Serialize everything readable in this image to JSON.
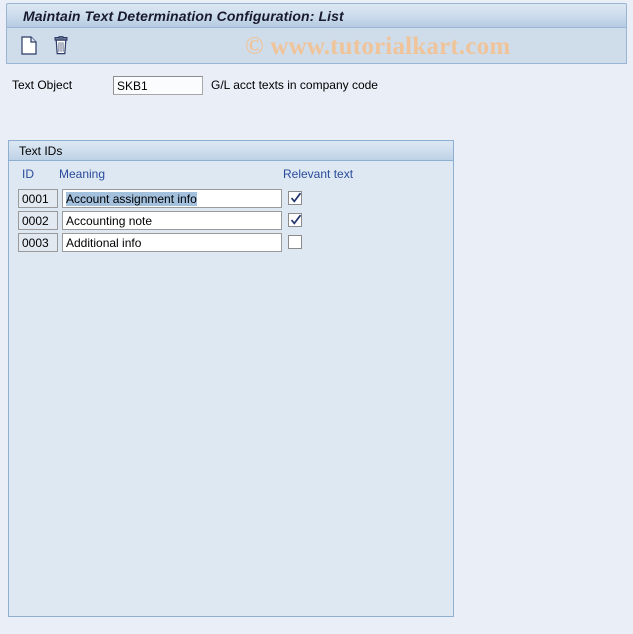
{
  "window": {
    "title": "Maintain Text Determination Configuration: List"
  },
  "toolbar": {
    "buttons": [
      {
        "name": "new-entries-icon",
        "tooltip": "New Entries"
      },
      {
        "name": "delete-icon",
        "tooltip": "Delete"
      }
    ]
  },
  "watermark": {
    "text": "© www.tutorialkart.com",
    "color": "#f0c49a"
  },
  "text_object": {
    "label": "Text Object",
    "value": "SKB1",
    "placeholder": "",
    "description": "G/L acct texts in company code"
  },
  "text_ids_panel": {
    "title": "Text IDs",
    "columns": {
      "id": "ID",
      "meaning": "Meaning",
      "relevant_text": "Relevant text"
    },
    "header_color": "#2a4b9b",
    "rows": [
      {
        "id": "0001",
        "meaning": "Account assignment info",
        "relevant_text": true,
        "selected": true
      },
      {
        "id": "0002",
        "meaning": "Accounting note",
        "relevant_text": true,
        "selected": false
      },
      {
        "id": "0003",
        "meaning": "Additional info",
        "relevant_text": false,
        "selected": false
      }
    ]
  }
}
